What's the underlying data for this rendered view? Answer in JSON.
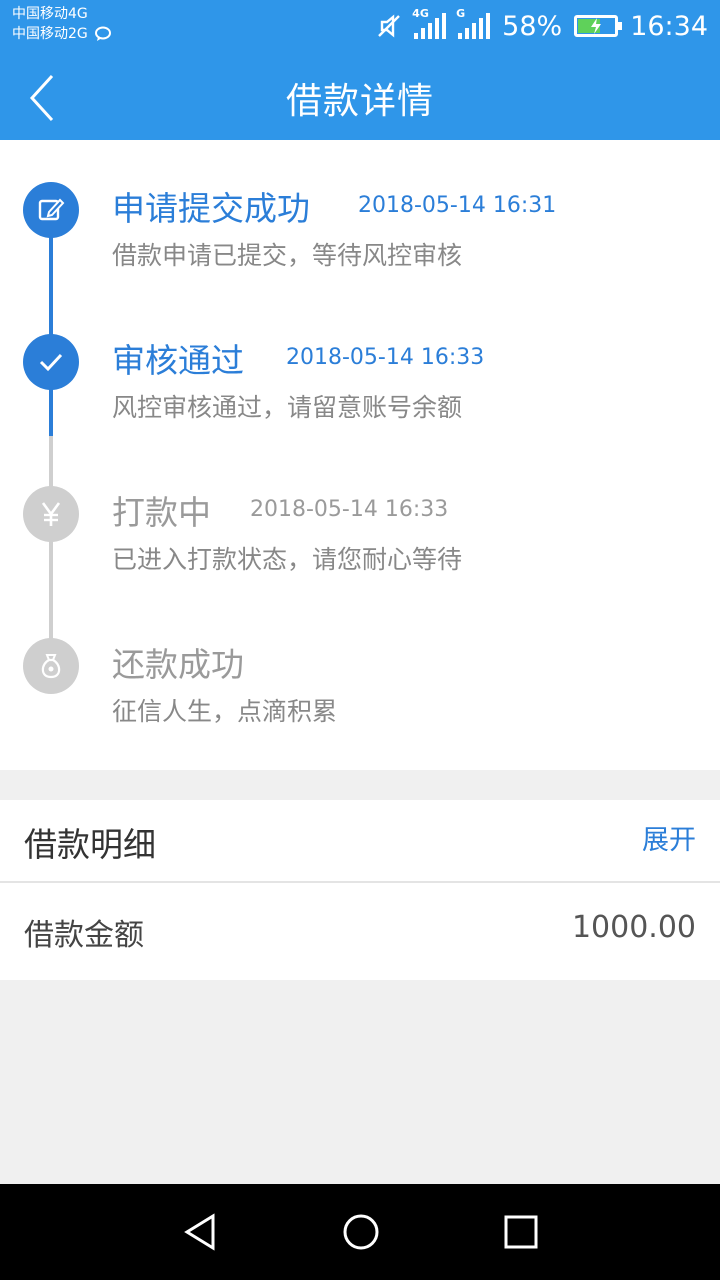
{
  "status_bar": {
    "carrier_1": "中国移动4G",
    "carrier_2": "中国移动2G",
    "signal_1_tag": "4G",
    "signal_2_tag": "G",
    "battery": "58%",
    "time": "16:34"
  },
  "header": {
    "title": "借款详情",
    "back_icon": "chevron-left-icon"
  },
  "timeline": {
    "steps": [
      {
        "title": "申请提交成功",
        "time": "2018-05-14 16:31",
        "desc": "借款申请已提交，等待风控审核",
        "icon": "edit-icon",
        "state": "done"
      },
      {
        "title": "审核通过",
        "time": "2018-05-14 16:33",
        "desc": "风控审核通过，请留意账号余额",
        "icon": "check-icon",
        "state": "done"
      },
      {
        "title": "打款中",
        "time": "2018-05-14 16:33",
        "desc": "已进入打款状态，请您耐心等待",
        "icon": "yen-icon",
        "state": "pending"
      },
      {
        "title": "还款成功",
        "time": "",
        "desc": "征信人生，点滴积累",
        "icon": "money-bag-icon",
        "state": "pending"
      }
    ]
  },
  "detail": {
    "title": "借款明细",
    "expand": "展开",
    "amount_label": "借款金额",
    "amount_value": "1000.00"
  },
  "colors": {
    "header_bg": "#2f96e9",
    "accent": "#2b7ed8",
    "inactive": "#cfcfcf"
  }
}
